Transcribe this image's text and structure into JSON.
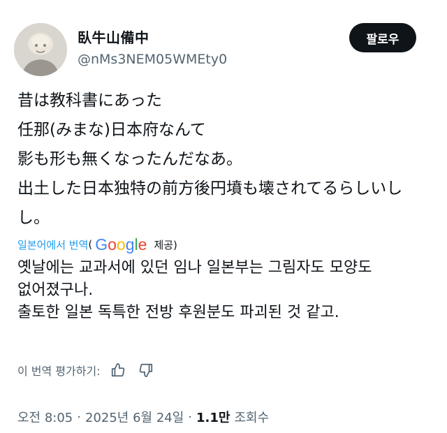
{
  "user": {
    "display_name": "臥牛山備中",
    "handle": "@nMs3NEM05WMEty0"
  },
  "follow_button": {
    "label": "팔로우"
  },
  "tweet": {
    "original_lines": [
      "昔は教科書にあった",
      "任那(みまな)日本府なんて",
      "影も形も無くなったんだなあ。",
      "出土した日本独特の前方後円墳も壊されてるらしいし",
      "し。"
    ],
    "translation": {
      "link_label": "일본어에서 번역",
      "paren": "(",
      "provider_logo_text": "Google",
      "provided_label": "제공)",
      "lines": [
        "옛날에는 교과서에 있던 임나 일본부는 그림자도 모양도",
        "없어졌구나.",
        "출토한 일본 독특한 전방 후원분도 파괴된 것 같고."
      ]
    },
    "rate": {
      "label": "이 번역 평가하기:"
    },
    "meta": {
      "time": "오전 8:05",
      "separator": "·",
      "date": "2025년 6월 24일",
      "views_count": "1.1만",
      "views_label": "조회수"
    }
  },
  "colors": {
    "text": "#0f1419",
    "secondary": "#536471",
    "link": "#1d9bf0",
    "google_blue": "#4285F4",
    "google_red": "#EA4335",
    "google_yellow": "#FBBC05",
    "google_green": "#34A853"
  }
}
